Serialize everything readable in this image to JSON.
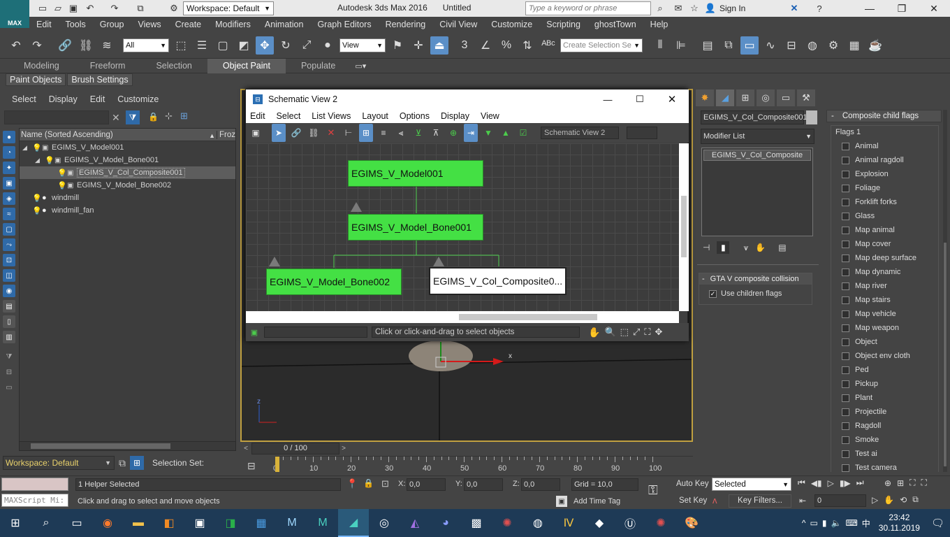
{
  "app": {
    "title": "Autodesk 3ds Max 2016",
    "document": "Untitled",
    "logo_text": "MAX",
    "workspace": "Workspace: Default",
    "search_placeholder": "Type a keyword or phrase",
    "sign_in": "Sign In"
  },
  "menu": [
    "Edit",
    "Tools",
    "Group",
    "Views",
    "Create",
    "Modifiers",
    "Animation",
    "Graph Editors",
    "Rendering",
    "Civil View",
    "Customize",
    "Scripting",
    "ghostTown",
    "Help"
  ],
  "toolbar": {
    "filter": "All",
    "ref_coord": "View",
    "selection_set_placeholder": "Create Selection Se"
  },
  "ribbon": {
    "tabs": [
      "Modeling",
      "Freeform",
      "Selection",
      "Object Paint",
      "Populate"
    ],
    "active_tab": "Object Paint",
    "sub_buttons": [
      "Paint Objects",
      "Brush Settings"
    ]
  },
  "explorer": {
    "menu": [
      "Select",
      "Display",
      "Edit",
      "Customize"
    ],
    "col_name": "Name (Sorted Ascending)",
    "col_frozen": "Froz",
    "rows": [
      {
        "name": "EGIMS_V_Model001"
      },
      {
        "name": "EGIMS_V_Model_Bone001"
      },
      {
        "name": "EGIMS_V_Col_Composite001"
      },
      {
        "name": "EGIMS_V_Model_Bone002"
      },
      {
        "name": "windmill"
      },
      {
        "name": "windmill_fan"
      }
    ],
    "workspace": "Workspace: Default",
    "selection_set": "Selection Set:"
  },
  "schematic": {
    "title": "Schematic View 2",
    "menu": [
      "Edit",
      "Select",
      "List Views",
      "Layout",
      "Options",
      "Display",
      "View"
    ],
    "view_name": "Schematic View 2",
    "nodes": [
      "EGIMS_V_Model001",
      "EGIMS_V_Model_Bone001",
      "EGIMS_V_Model_Bone002",
      "EGIMS_V_Col_Composite0..."
    ],
    "status": "Click or click-and-drag to select objects"
  },
  "modify": {
    "object_name": "EGIMS_V_Col_Composite001",
    "modifier_list": "Modifier List",
    "stack_item": "EGIMS_V_Col_Composite"
  },
  "gta": {
    "title": "GTA V composite collision",
    "use_children_flags": "Use children flags"
  },
  "flags": {
    "title": "Composite child flags",
    "group": "Flags 1",
    "items": [
      "Animal",
      "Animal ragdoll",
      "Explosion",
      "Foliage",
      "Forklift forks",
      "Glass",
      "Map animal",
      "Map cover",
      "Map deep surface",
      "Map dynamic",
      "Map river",
      "Map stairs",
      "Map vehicle",
      "Map weapon",
      "Object",
      "Object env cloth",
      "Ped",
      "Pickup",
      "Plant",
      "Projectile",
      "Ragdoll",
      "Smoke",
      "Test ai",
      "Test camera"
    ]
  },
  "timeline": {
    "frame": "0 / 100",
    "ticks": [
      "0",
      "10",
      "20",
      "30",
      "40",
      "50",
      "60",
      "70",
      "80",
      "90",
      "100"
    ]
  },
  "status": {
    "maxscript": "MAXScript Mi:",
    "selected": "1 Helper Selected",
    "prompt": "Click and drag to select and move objects",
    "x_label": "X:",
    "x_val": "0,0",
    "y_label": "Y:",
    "y_val": "0,0",
    "z_label": "Z:",
    "z_val": "0,0",
    "grid": "Grid = 10,0",
    "add_time_tag": "Add Time Tag",
    "auto_key": "Auto Key",
    "set_key": "Set Key",
    "key_mode": "Selected",
    "key_filters": "Key Filters...",
    "frame_field": "0"
  },
  "viewport": {
    "axis_x": "x",
    "axis_z": "z"
  },
  "taskbar": {
    "time": "23:42",
    "date": "30.11.2019"
  }
}
